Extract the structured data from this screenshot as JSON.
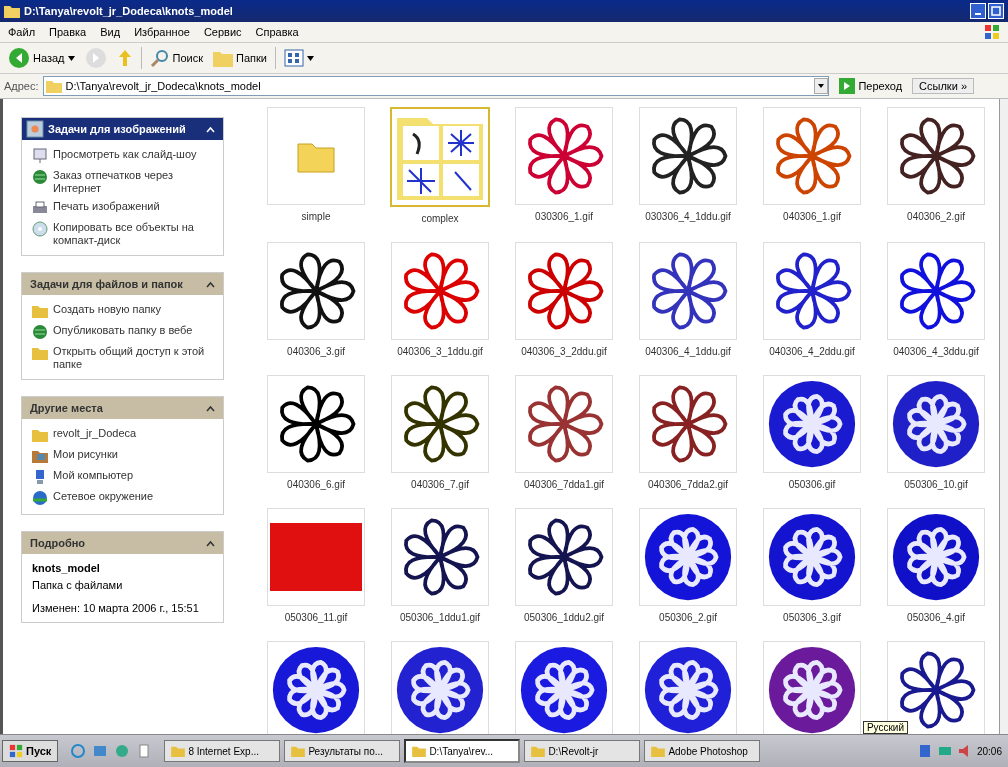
{
  "window": {
    "title": "D:\\Tanya\\revolt_jr_Dodeca\\knots_model"
  },
  "menu": [
    "Файл",
    "Правка",
    "Вид",
    "Избранное",
    "Сервис",
    "Справка"
  ],
  "toolbar": {
    "back": "Назад",
    "search": "Поиск",
    "folders": "Папки"
  },
  "address": {
    "label": "Адрес:",
    "value": "D:\\Tanya\\revolt_jr_Dodeca\\knots_model",
    "go": "Переход",
    "links": "Ссылки »"
  },
  "sidebar": {
    "panels": [
      {
        "title": "Задачи для изображений",
        "kind": "primary",
        "items": [
          {
            "label": "Просмотреть как слайд-шоу",
            "kind": "slideshow"
          },
          {
            "label": "Заказ отпечатков через Интернет",
            "kind": "globe"
          },
          {
            "label": "Печать изображений",
            "kind": "printer"
          },
          {
            "label": "Копировать все объекты на компакт-диск",
            "kind": "disc"
          }
        ]
      },
      {
        "title": "Задачи для файлов и папок",
        "kind": "normal",
        "items": [
          {
            "label": "Создать новую папку",
            "kind": "folder"
          },
          {
            "label": "Опубликовать папку в вебе",
            "kind": "globe"
          },
          {
            "label": "Открыть общий доступ к этой папке",
            "kind": "folder"
          }
        ]
      },
      {
        "title": "Другие места",
        "kind": "normal",
        "items": [
          {
            "label": "revolt_jr_Dodeca",
            "kind": "folder"
          },
          {
            "label": "Мои рисунки",
            "kind": "pictures"
          },
          {
            "label": "Мой компьютер",
            "kind": "computer"
          },
          {
            "label": "Сетевое окружение",
            "kind": "network"
          }
        ]
      },
      {
        "title": "Подробно",
        "kind": "details",
        "details": {
          "name": "knots_model",
          "type": "Папка с файлами",
          "modified": "Изменен: 10 марта 2006 г., 15:51"
        }
      }
    ]
  },
  "files": [
    {
      "label": "simple",
      "kind": "folder"
    },
    {
      "label": "complex",
      "kind": "folder-preview"
    },
    {
      "label": "030306_1.gif",
      "kind": "image",
      "color": "#cc0033"
    },
    {
      "label": "030306_4_1ddu.gif",
      "kind": "image",
      "color": "#222222"
    },
    {
      "label": "040306_1.gif",
      "kind": "image",
      "color": "#cc4400"
    },
    {
      "label": "040306_2.gif",
      "kind": "image",
      "color": "#442222"
    },
    {
      "label": "040306_3.gif",
      "kind": "image",
      "color": "#111111"
    },
    {
      "label": "040306_3_1ddu.gif",
      "kind": "image",
      "color": "#dd0000"
    },
    {
      "label": "040306_3_2ddu.gif",
      "kind": "image",
      "color": "#cc0000"
    },
    {
      "label": "040306_4_1ddu.gif",
      "kind": "image",
      "color": "#3333bb"
    },
    {
      "label": "040306_4_2ddu.gif",
      "kind": "image",
      "color": "#2222cc"
    },
    {
      "label": "040306_4_3ddu.gif",
      "kind": "image",
      "color": "#1111dd"
    },
    {
      "label": "040306_6.gif",
      "kind": "image",
      "color": "#000000"
    },
    {
      "label": "040306_7.gif",
      "kind": "image",
      "color": "#333300"
    },
    {
      "label": "040306_7dda1.gif",
      "kind": "image",
      "color": "#993333"
    },
    {
      "label": "040306_7dda2.gif",
      "kind": "image",
      "color": "#882222"
    },
    {
      "label": "050306.gif",
      "kind": "disc",
      "color": "#1a1ad0"
    },
    {
      "label": "050306_10.gif",
      "kind": "disc",
      "color": "#2020c8"
    },
    {
      "label": "050306_11.gif",
      "kind": "photo",
      "color": "#e01010"
    },
    {
      "label": "050306_1ddu1.gif",
      "kind": "image",
      "color": "#141450"
    },
    {
      "label": "050306_1ddu2.gif",
      "kind": "image",
      "color": "#141450"
    },
    {
      "label": "050306_2.gif",
      "kind": "disc",
      "color": "#1414d8"
    },
    {
      "label": "050306_3.gif",
      "kind": "disc",
      "color": "#1414d0"
    },
    {
      "label": "050306_4.gif",
      "kind": "disc",
      "color": "#1010c8"
    },
    {
      "kind": "disc",
      "color": "#1818d8"
    },
    {
      "kind": "disc",
      "color": "#2222d0"
    },
    {
      "kind": "disc",
      "color": "#1a1ae0"
    },
    {
      "kind": "disc",
      "color": "#2020d8"
    },
    {
      "kind": "disc",
      "color": "#6a1a9a"
    },
    {
      "kind": "image",
      "color": "#1a1a90"
    }
  ],
  "taskbar": {
    "start": "Пуск",
    "tasks": [
      {
        "label": "8 Internet Exp...",
        "selected": false
      },
      {
        "label": "Результаты по...",
        "selected": false
      },
      {
        "label": "D:\\Tanya\\rev...",
        "selected": true
      },
      {
        "label": "D:\\Revolt-jr",
        "selected": false
      },
      {
        "label": "Adobe Photoshop",
        "selected": false
      }
    ],
    "tooltip": "Русский",
    "clock": "20:06"
  }
}
